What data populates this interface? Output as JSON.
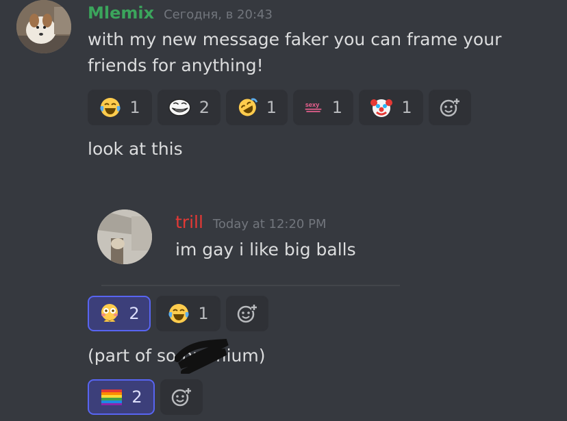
{
  "colors": {
    "background": "#36393f",
    "author_green": "#3ba55c",
    "author_red": "#e53935",
    "reaction_bg": "#2f3136",
    "reaction_active_border": "#5865f2"
  },
  "message1": {
    "author": "Mlemix",
    "timestamp": "Сегодня, в 20:43",
    "lines": [
      "with my new message faker you can frame your",
      "friends for anything!"
    ],
    "reactions": [
      {
        "icon": "joy-emoji-icon",
        "count": "1"
      },
      {
        "icon": "trollface-emoji-icon",
        "count": "2"
      },
      {
        "icon": "rofl-emoji-icon",
        "count": "1"
      },
      {
        "icon": "sexy-text-emoji-icon",
        "count": "1"
      },
      {
        "icon": "clown-emoji-icon",
        "count": "1"
      }
    ]
  },
  "message2": {
    "text": "look at this"
  },
  "quoted": {
    "author": "trill",
    "timestamp": "Today at 12:20 PM",
    "text": "im gay i like big balls"
  },
  "message3": {
    "reactions": [
      {
        "icon": "flushed-hands-emoji-icon",
        "count": "2",
        "active": true
      },
      {
        "icon": "joy-emoji-icon",
        "count": "1",
        "active": false
      }
    ]
  },
  "message4": {
    "text": "(part of so         premium)",
    "reactions": [
      {
        "icon": "rainbow-flag-emoji-icon",
        "count": "2",
        "active": true
      }
    ]
  }
}
